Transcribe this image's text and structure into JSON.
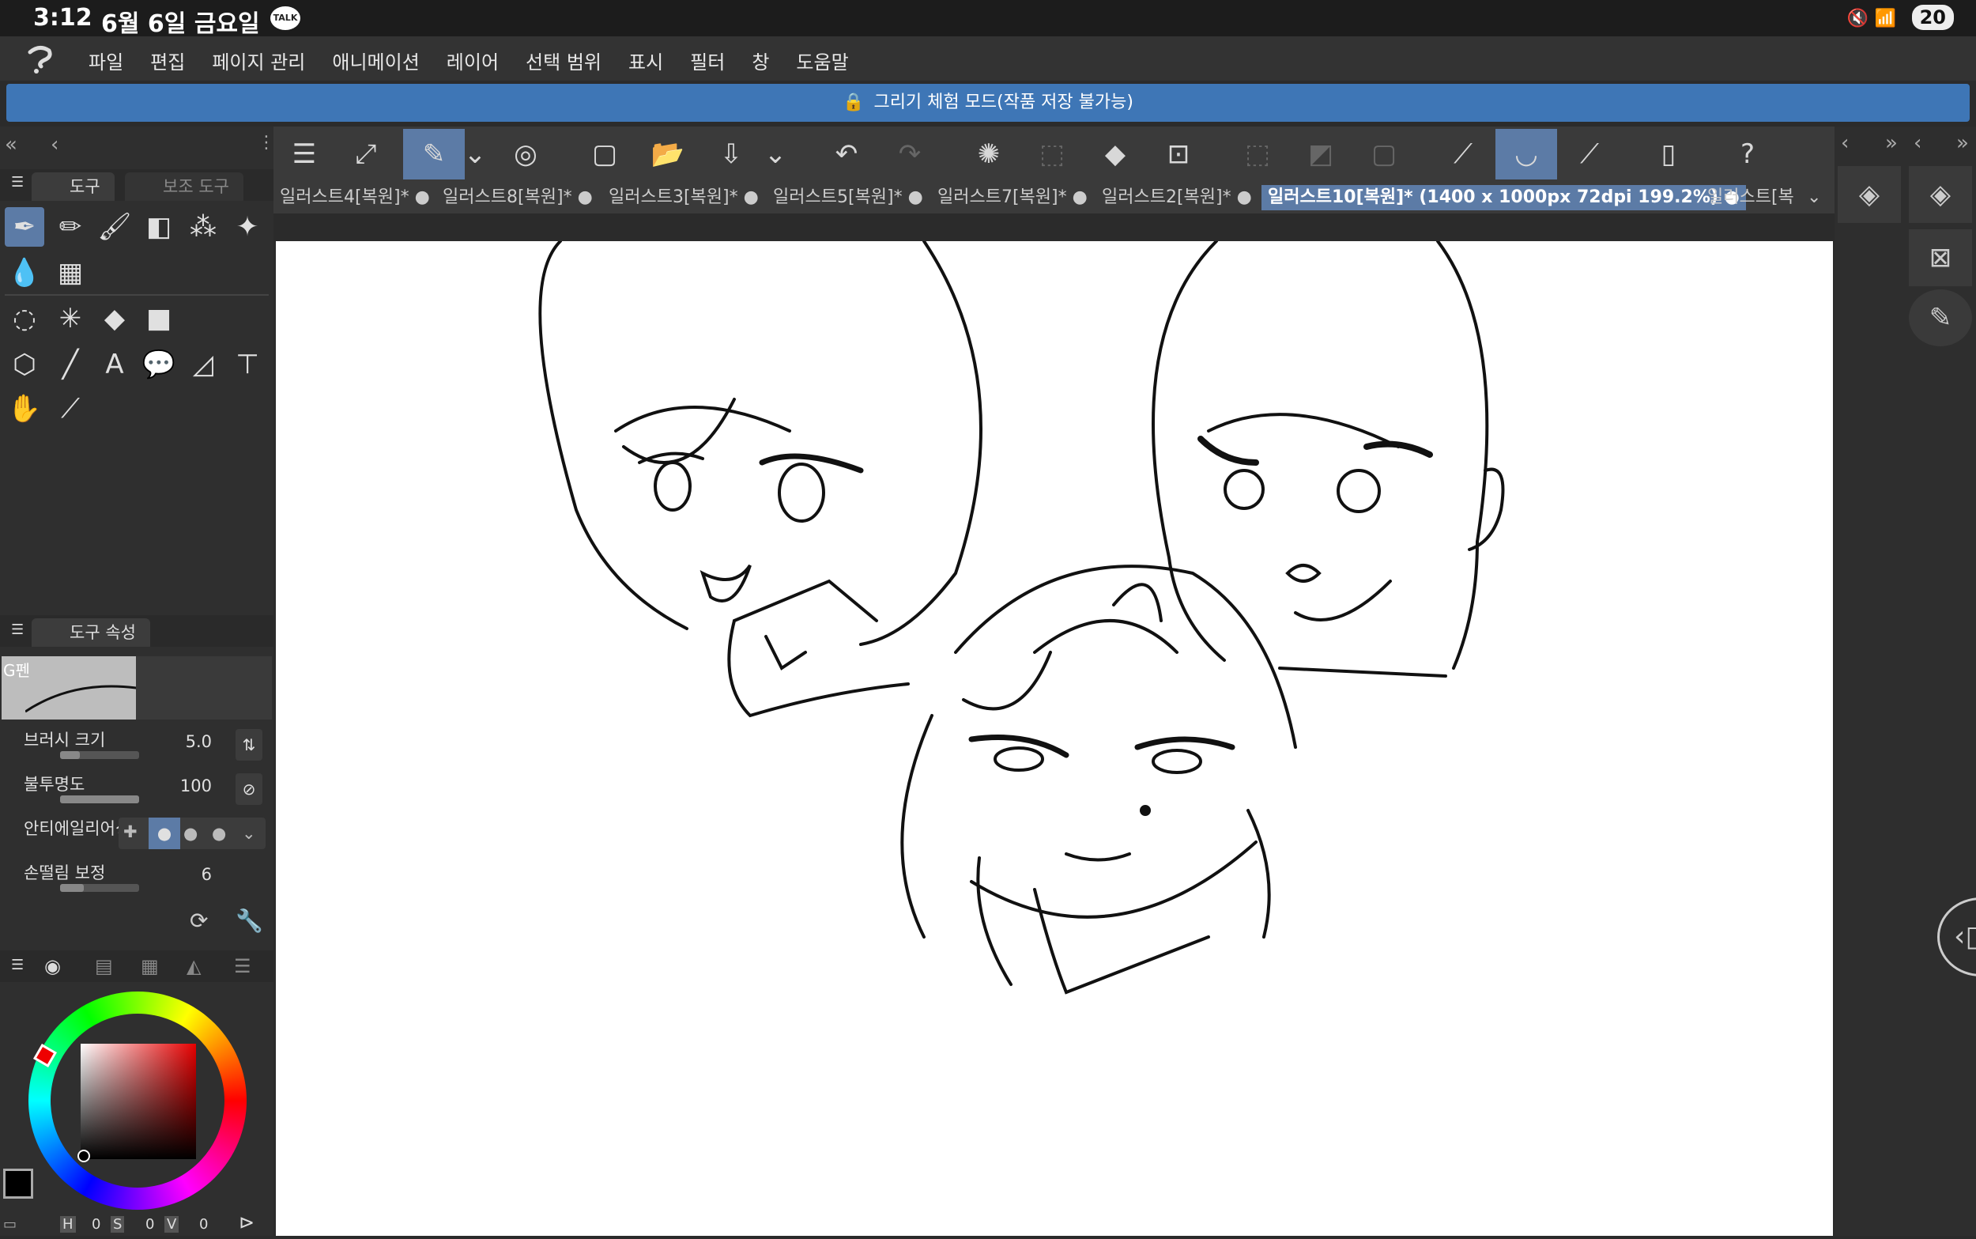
{
  "status": {
    "time": "3:12",
    "date": "6월 6일 금요일",
    "talk": "TALK",
    "battery": "20",
    "icons": [
      "mute-icon",
      "wifi-icon"
    ]
  },
  "menu": {
    "items": [
      "파일",
      "편집",
      "페이지 관리",
      "애니메이션",
      "레이어",
      "선택 범위",
      "표시",
      "필터",
      "창",
      "도움말"
    ]
  },
  "notice": {
    "text": "그리기 체험 모드(작품 저장 불가능)"
  },
  "toolbar": {
    "icons": [
      "menu-icon",
      "resize-icon",
      "brush-mode-icon",
      "chevron-down-icon",
      "spiral-icon",
      "new-canvas-icon",
      "open-folder-icon",
      "export-icon",
      "chevron-down-icon",
      "undo-icon",
      "redo-icon",
      "loading-icon",
      "select-all-icon",
      "fill-icon",
      "transform-icon",
      "deselect-icon",
      "invert-selection-icon",
      "border-selection-icon",
      "ruler-icon",
      "pen-stabilizer-icon",
      "ruler-edit-icon",
      "phone-icon",
      "help-icon"
    ]
  },
  "tabs": [
    {
      "label": "일러스트4[복원]*",
      "dot": "●"
    },
    {
      "label": "일러스트8[복원]*",
      "dot": "●"
    },
    {
      "label": "일러스트3[복원]*",
      "dot": "●"
    },
    {
      "label": "일러스트5[복원]*",
      "dot": "●"
    },
    {
      "label": "일러스트7[복원]*",
      "dot": "●"
    },
    {
      "label": "일러스트2[복원]*",
      "dot": "●"
    },
    {
      "label": "일러스트10[복원]* (1400 x 1000px 72dpi 199.2%)",
      "dot": "●",
      "active": true
    },
    {
      "label": "일러스트[복",
      "dot": ""
    }
  ],
  "toolpanel": {
    "tab_tool": "도구",
    "tab_subtool": "보조 도구"
  },
  "toolprops": {
    "title": "도구 속성",
    "brush_name": "G펜",
    "brush_size_label": "브러시 크기",
    "brush_size": "5.0",
    "brush_size_level": 0.25,
    "opacity_label": "불투명도",
    "opacity": "100",
    "opacity_level": 1.0,
    "antialias_label": "안티에일리어싱",
    "stabilization_label": "손떨림 보정",
    "stabilization": "6",
    "stabilization_level": 0.3
  },
  "color": {
    "h": "H",
    "h_val": "0",
    "s": "S",
    "s_val": "0",
    "v": "V",
    "v_val": "0",
    "main_color": "#000000",
    "sub_color": "#5a7fd6"
  }
}
